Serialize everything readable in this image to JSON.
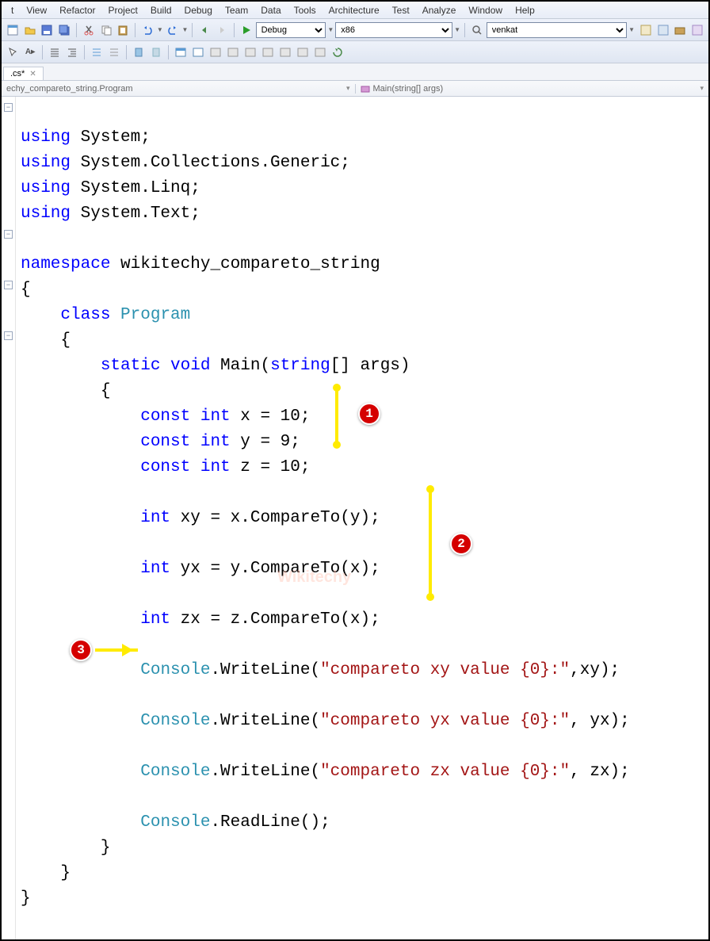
{
  "menu": [
    "t",
    "View",
    "Refactor",
    "Project",
    "Build",
    "Debug",
    "Team",
    "Data",
    "Tools",
    "Architecture",
    "Test",
    "Analyze",
    "Window",
    "Help"
  ],
  "toolbar1": {
    "combo_config": "Debug",
    "combo_platform": "x86",
    "combo_find": "venkat"
  },
  "tab": {
    "name": ".cs*"
  },
  "breadcrumb": {
    "left": "echy_compareto_string.Program",
    "right": "Main(string[] args)"
  },
  "code": {
    "l1a": "using",
    "l1b": " System;",
    "l2a": "using",
    "l2b": " System.Collections.Generic;",
    "l3a": "using",
    "l3b": " System.Linq;",
    "l4a": "using",
    "l4b": " System.Text;",
    "l6a": "namespace",
    "l6b": " wikitechy_compareto_string",
    "l7": "{",
    "l8a": "    class ",
    "l8b": "Program",
    "l9": "    {",
    "l10a": "        static void ",
    "l10b": "Main(",
    "l10c": "string",
    "l10d": "[] args)",
    "l11": "        {",
    "l12a": "            const int",
    "l12b": " x = 10;",
    "l13a": "            const int",
    "l13b": " y = 9;",
    "l14a": "            const int",
    "l14b": " z = 10;",
    "l16a": "            int",
    "l16b": " xy = x.CompareTo(y);",
    "l18a": "            int",
    "l18b": " yx = y.CompareTo(x);",
    "l20a": "            int",
    "l20b": " zx = z.CompareTo(x);",
    "l22a": "            ",
    "l22b": "Console",
    "l22c": ".WriteLine(",
    "l22d": "\"compareto xy value {0}:\"",
    "l22e": ",xy);",
    "l24a": "            ",
    "l24b": "Console",
    "l24c": ".WriteLine(",
    "l24d": "\"compareto yx value {0}:\"",
    "l24e": ", yx);",
    "l26a": "            ",
    "l26b": "Console",
    "l26c": ".WriteLine(",
    "l26d": "\"compareto zx value {0}:\"",
    "l26e": ", zx);",
    "l28a": "            ",
    "l28b": "Console",
    "l28c": ".ReadLine();",
    "l29": "        }",
    "l30": "    }",
    "l31": "}"
  },
  "annotations": {
    "b1": "1",
    "b2": "2",
    "b3": "3"
  },
  "watermark": "Wikitechy"
}
